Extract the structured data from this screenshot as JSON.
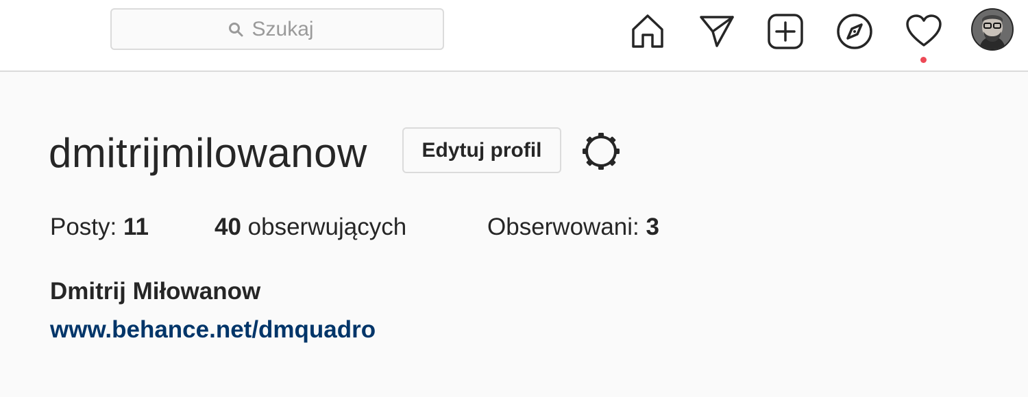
{
  "header": {
    "search": {
      "placeholder": "Szukaj",
      "value": ""
    },
    "nav": {
      "home": "home-icon",
      "direct": "paper-plane-icon",
      "new_post": "plus-square-icon",
      "explore": "compass-icon",
      "activity": "heart-icon",
      "profile": "avatar"
    },
    "has_notification": true
  },
  "profile": {
    "username": "dmitrijmilowanow",
    "edit_button": "Edytuj profil",
    "settings_icon": "gear-icon",
    "stats": {
      "posts_label": "Posty: ",
      "posts_count": "11",
      "followers_count": "40",
      "followers_label": " obserwujących",
      "following_label": "Obserwowani: ",
      "following_count": "3"
    },
    "full_name": "Dmitrij Miłowanow",
    "website": "www.behance.net/dmquadro"
  },
  "colors": {
    "link": "#003569",
    "notification": "#ed4956",
    "border": "#dbdbdb",
    "background": "#fafafa"
  }
}
